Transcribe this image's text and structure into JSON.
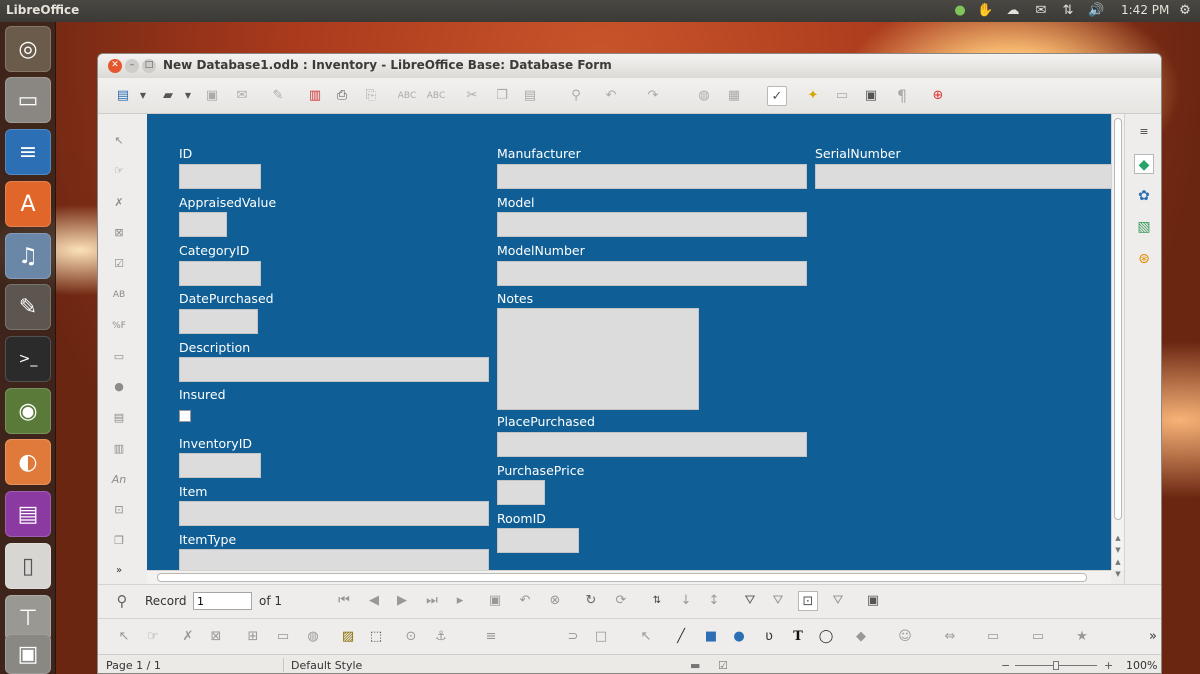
{
  "topbar": {
    "app_name": "LibreOffice",
    "clock": "1:42 PM"
  },
  "window": {
    "title": "New Database1.odb : Inventory - LibreOffice Base: Database Form"
  },
  "form": {
    "col1": [
      {
        "label": "ID"
      },
      {
        "label": "AppraisedValue"
      },
      {
        "label": "CategoryID"
      },
      {
        "label": "DatePurchased"
      },
      {
        "label": "Description"
      },
      {
        "label": "Insured"
      },
      {
        "label": "InventoryID"
      },
      {
        "label": "Item"
      },
      {
        "label": "ItemType"
      }
    ],
    "col2": [
      {
        "label": "Manufacturer"
      },
      {
        "label": "Model"
      },
      {
        "label": "ModelNumber"
      },
      {
        "label": "Notes"
      },
      {
        "label": "PlacePurchased"
      },
      {
        "label": "PurchasePrice"
      },
      {
        "label": "RoomID"
      }
    ],
    "col3": [
      {
        "label": "SerialNumber"
      }
    ]
  },
  "navbar": {
    "record_label": "Record",
    "record_value": "1",
    "of_label": "of 1"
  },
  "statusbar": {
    "page": "Page 1 / 1",
    "style": "Default Style",
    "zoom": "100%"
  },
  "colors": {
    "form_background": "#0f5f96",
    "field_background": "#dcdcdc"
  },
  "icons": {
    "launcher": [
      "ubuntu-dash-icon",
      "files-icon",
      "writer-icon",
      "software-center-icon",
      "rhythmbox-icon",
      "gimp-icon",
      "terminal-icon",
      "chrome-icon",
      "mango-icon",
      "base-icon",
      "document-icon",
      "scanner-icon",
      "printer-icon"
    ],
    "toolbar": [
      "new-icon",
      "open-icon",
      "save-icon",
      "email-icon",
      "edit-icon",
      "pdf-icon",
      "print-icon",
      "print-preview-icon",
      "spellcheck-icon",
      "autospell-icon",
      "cut-icon",
      "copy-icon",
      "paste-icon",
      "clone-icon",
      "undo-icon",
      "redo-icon",
      "navigator-icon",
      "table-icon",
      "design-mode-icon",
      "control-wizard-icon",
      "form-navigator-icon",
      "activation-order-icon",
      "formatting-marks-icon",
      "help-icon"
    ]
  }
}
